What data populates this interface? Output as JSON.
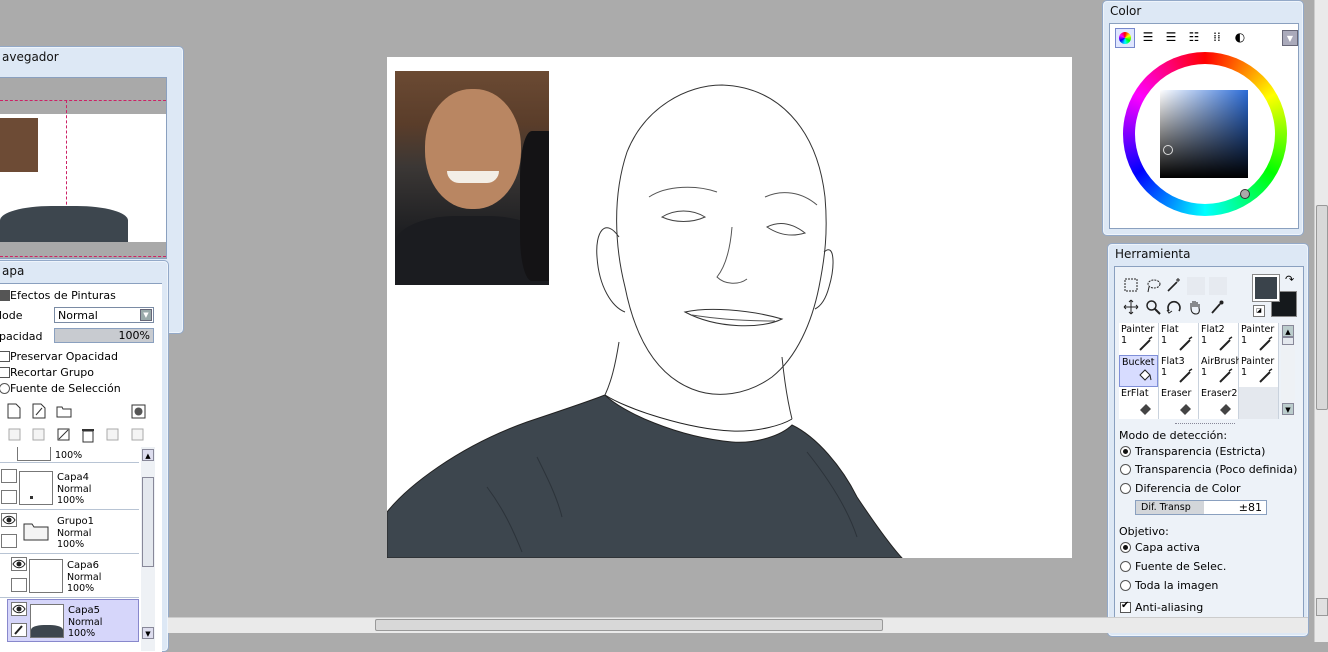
{
  "navigator": {
    "title": "avegador"
  },
  "layer_panel": {
    "title": "apa",
    "paint_effects_label": "Efectos de Pinturas",
    "mode_label": "lode",
    "mode_value": "Normal",
    "opacity_label": "pacidad",
    "opacity_value": "100%",
    "opacity_fraction": 1.0,
    "preserve_opacity": "Preservar Opacidad",
    "clip_group": "Recortar Grupo",
    "selection_source": "Fuente de Selección",
    "layers": [
      {
        "name": "",
        "mode": "",
        "opacity": "100%"
      },
      {
        "name": "Capa4",
        "mode": "Normal",
        "opacity": "100%"
      },
      {
        "name": "Grupo1",
        "mode": "Normal",
        "opacity": "100%"
      },
      {
        "name": "Capa6",
        "mode": "Normal",
        "opacity": "100%"
      },
      {
        "name": "Capa5",
        "mode": "Normal",
        "opacity": "100%"
      }
    ]
  },
  "color_panel": {
    "title": "Color",
    "fg_color": "#3a434b",
    "bg_color": "#15191c"
  },
  "tool_panel": {
    "title": "Herramienta",
    "brushes": [
      {
        "name": "Painter",
        "size": "1"
      },
      {
        "name": "Flat",
        "size": "1"
      },
      {
        "name": "Flat2",
        "size": "1"
      },
      {
        "name": "Painter",
        "size": "1"
      },
      {
        "name": "Bucket",
        "size": ""
      },
      {
        "name": "Flat3",
        "size": "1"
      },
      {
        "name": "AirBrush",
        "size": "1"
      },
      {
        "name": "Painter",
        "size": "1"
      },
      {
        "name": "ErFlat",
        "size": ""
      },
      {
        "name": "Eraser",
        "size": ""
      },
      {
        "name": "Eraser2",
        "size": ""
      },
      {
        "name": "",
        "size": ""
      }
    ],
    "detection_label": "Modo de detección:",
    "detection_options": [
      "Transparencia (Estricta)",
      "Transparencia (Poco definida)",
      "Diferencia de Color"
    ],
    "tolerance_label": "Dif. Transp",
    "tolerance_value": "±81",
    "target_label": "Objetivo:",
    "target_options": [
      "Capa activa",
      "Fuente de Selec.",
      "Toda la imagen"
    ],
    "antialiasing_label": "Anti-aliasing"
  },
  "colors": {
    "shirt": "#3d464e",
    "panel_bg": "#dde8f5",
    "workspace": "#ababab"
  }
}
